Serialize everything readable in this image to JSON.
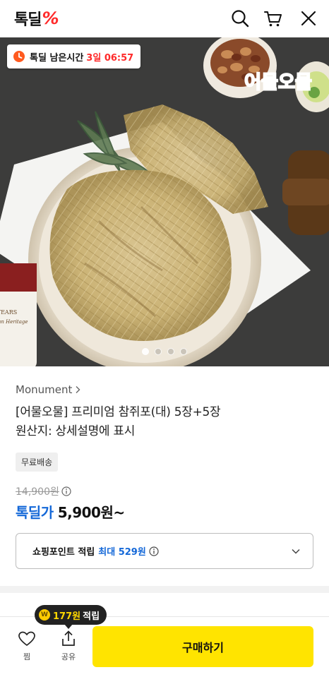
{
  "header": {
    "logo_text": "톡딜",
    "logo_mark": "%"
  },
  "hero": {
    "timer_label": "톡딜 남은시간",
    "timer_count": "3일 06:57",
    "image_text": "어물오물",
    "can_text": "YEARS",
    "can_subtext": "Korean Heritage",
    "slide_count": 4,
    "active_slide": 1
  },
  "product": {
    "brand": "Monument",
    "title_line1": "[어물오물] 프리미엄 참쥐포(대) 5장+5장",
    "title_line2": "원산지: 상세설명에 표시",
    "badge": "무료배송",
    "original_price": "14,900원",
    "deal_label": "톡딜가",
    "deal_price": "5,900원~"
  },
  "points": {
    "label": "쇼핑포인트 적립",
    "max": "최대 529원"
  },
  "bottom_bar": {
    "like_label": "찜",
    "share_label": "공유",
    "buy_label": "구매하기",
    "tooltip_coin": "W",
    "tooltip_amount": "177원",
    "tooltip_suffix": "적립"
  },
  "colors": {
    "brand_red": "#ff2a2a",
    "deal_blue": "#1468d8",
    "buy_yellow": "#ffe400"
  },
  "icons": [
    "search-icon",
    "cart-icon",
    "close-icon",
    "clock-icon",
    "chevron-right-icon",
    "info-icon",
    "chevron-down-icon",
    "heart-icon",
    "share-icon"
  ]
}
